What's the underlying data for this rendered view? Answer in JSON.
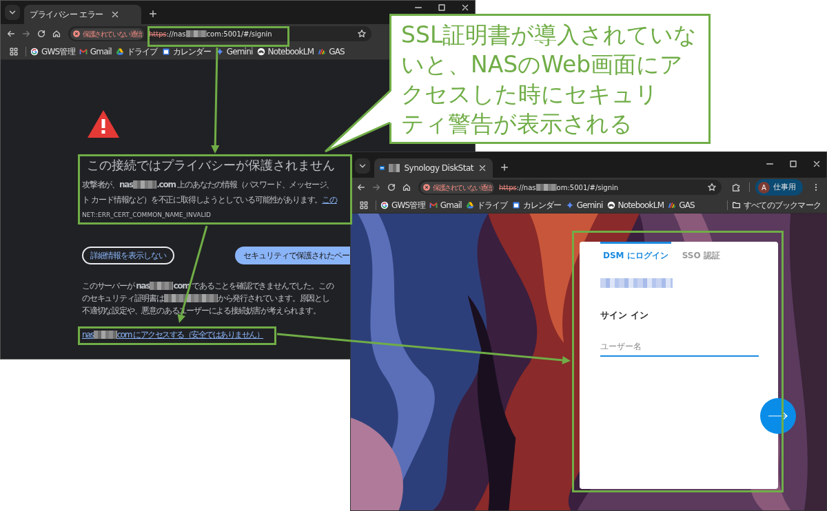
{
  "error_window": {
    "tab": {
      "segments": [
        {
          "kind": "text",
          "text": "プライバシー エラー"
        }
      ]
    },
    "address": {
      "security_chip": "保護されていない通信",
      "url": [
        {
          "kind": "struck",
          "text": "https"
        },
        {
          "kind": "text",
          "text": "://nas"
        },
        {
          "kind": "redacted"
        },
        {
          "kind": "text",
          "text": "com:5001/#/signin"
        }
      ]
    },
    "bookmarks": [
      {
        "kind": "google",
        "label": "GWS管理"
      },
      {
        "kind": "gmail",
        "label": "Gmail"
      },
      {
        "kind": "drive",
        "label": "ドライブ"
      },
      {
        "kind": "calendar",
        "label": "カレンダー"
      },
      {
        "kind": "gemini",
        "label": "Gemini"
      },
      {
        "kind": "notebooklm",
        "label": "NotebookLM"
      },
      {
        "kind": "gas",
        "label": "GAS"
      }
    ],
    "page": {
      "title": "この接続ではプライバシーが保護されません",
      "description": [
        [
          {
            "kind": "text",
            "text": "攻撃者が、**nas**"
          },
          {
            "kind": "redacted"
          },
          {
            "kind": "text",
            "text": "**.com** 上のあなたの情報（パスワード、メッセージ、"
          }
        ],
        [
          {
            "kind": "text",
            "text": "ト カード情報など）を不正に取得しようとしている可能性があります。"
          },
          {
            "kind": "link",
            "text": "この"
          }
        ]
      ],
      "error_code": "NET::ERR_CERT_COMMON_NAME_INVALID",
      "buttons": [
        {
          "kind": "outline",
          "label": "詳細情報を表示しない"
        },
        {
          "kind": "primary",
          "label": "セキュリティで保護されたペー"
        }
      ],
      "details": [
        [
          {
            "kind": "text",
            "text": "このサーバーが **nas**"
          },
          {
            "kind": "redacted"
          },
          {
            "kind": "text",
            "text": "**com** であることを確認できませんでした。この"
          }
        ],
        [
          {
            "kind": "text",
            "text": "のセキュリティ証明書は"
          },
          {
            "kind": "redacted"
          },
          {
            "kind": "text",
            "text": "から発行されています。原因とし"
          }
        ],
        [
          {
            "kind": "text",
            "text": "不適切な設定や、悪意のあるユーザーによる接続妨害が考えられます。"
          }
        ]
      ],
      "proceed_link": [
        {
          "kind": "link",
          "text": "nas"
        },
        {
          "kind": "redacted"
        },
        {
          "kind": "link",
          "text": "com にアクセスする（安全ではありません）"
        }
      ]
    }
  },
  "signin_window": {
    "tab": {
      "segments": [
        {
          "kind": "favicon"
        },
        {
          "kind": "redacted"
        },
        {
          "kind": "text",
          "text": "Synology DiskStat"
        }
      ]
    },
    "address": {
      "security_chip": "保護されていない通信",
      "url": [
        {
          "kind": "struck",
          "text": "https"
        },
        {
          "kind": "text",
          "text": "://nas"
        },
        {
          "kind": "redacted"
        },
        {
          "kind": "text",
          "text": "om:5001/#/signin"
        }
      ]
    },
    "profile": {
      "initial": "A",
      "label": "仕事用"
    },
    "bookmarks": [
      {
        "kind": "google",
        "label": "GWS管理"
      },
      {
        "kind": "gmail",
        "label": "Gmail"
      },
      {
        "kind": "drive",
        "label": "ドライブ"
      },
      {
        "kind": "calendar",
        "label": "カレンダー"
      },
      {
        "kind": "gemini",
        "label": "Gemini"
      },
      {
        "kind": "notebooklm",
        "label": "NotebookLM"
      },
      {
        "kind": "gas",
        "label": "GAS"
      }
    ],
    "all_bookmarks": "すべてのブックマーク",
    "login": {
      "tabs": [
        {
          "label": "DSM にログイン",
          "selected": true
        },
        {
          "label": "SSO 認証",
          "selected": false
        }
      ],
      "heading": "サイン イン",
      "username": {
        "placeholder": "ユーザー名"
      }
    }
  },
  "callout": {
    "lines": [
      "SSL証明書が導入されていな",
      "いと、NASのWeb画面にア",
      "クセスした時にセキュリ",
      "ティ警告が表示される"
    ]
  }
}
